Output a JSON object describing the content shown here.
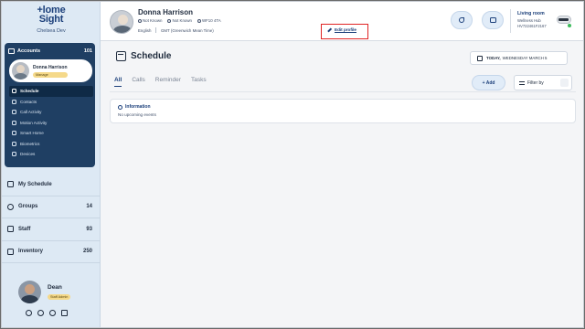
{
  "brand": {
    "logo_line1": "+lome",
    "logo_line2": "Sight",
    "org": "Chelsea Dev"
  },
  "accounts": {
    "label": "Accounts",
    "count": "101",
    "user": {
      "name": "Donna Harrison",
      "badge": "Manage"
    },
    "items": [
      {
        "label": "Schedule",
        "icon": "calendar-icon",
        "active": true
      },
      {
        "label": "Contacts",
        "icon": "contacts-icon"
      },
      {
        "label": "Call Activity",
        "icon": "phone-icon"
      },
      {
        "label": "Motion Activity",
        "icon": "motion-icon"
      },
      {
        "label": "Smart Home",
        "icon": "home-icon"
      },
      {
        "label": "Biometrics",
        "icon": "heart-icon"
      },
      {
        "label": "Devices",
        "icon": "device-icon"
      }
    ]
  },
  "side_links": [
    {
      "label": "My Schedule",
      "count": ""
    },
    {
      "label": "Groups",
      "count": "14"
    },
    {
      "label": "Staff",
      "count": "93"
    },
    {
      "label": "Inventory",
      "count": "250"
    }
  ],
  "me": {
    "name": "Dean",
    "badge": "Staff Admin"
  },
  "topbar": {
    "name": "Donna Harrison",
    "meta": [
      "Not Known",
      "Not Known",
      "WF10 4TA"
    ],
    "language": "English",
    "timezone": "GMT (Greenwich Mean Time)",
    "edit_profile": "Edit profile",
    "hub_title": "Living room",
    "hub_sub": "Wellness Hub",
    "hub_id": "HV722461F2167",
    "highlight_color": "#e02424"
  },
  "main": {
    "title": "Schedule",
    "date_prefix": "TODAY,",
    "date": "WEDNESDAY MARCH 5",
    "tabs": [
      "All",
      "Calls",
      "Reminder",
      "Tasks"
    ],
    "add_label": "+ Add",
    "filter_label": "Filter by",
    "info_title": "Information",
    "info_message": "No upcoming events"
  }
}
